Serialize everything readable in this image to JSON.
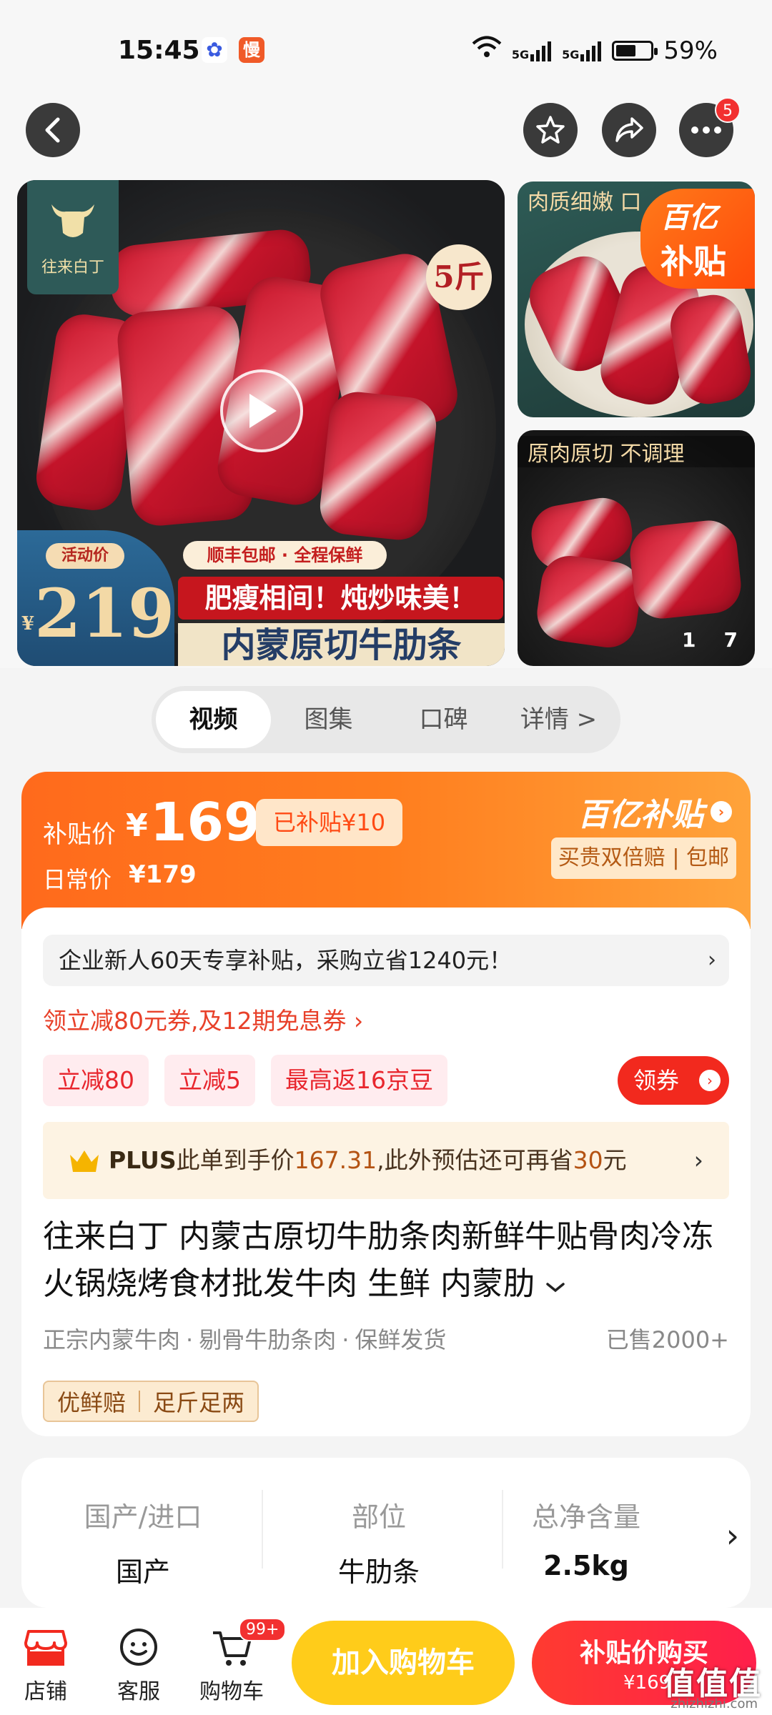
{
  "status_bar": {
    "time": "15:45",
    "app_icon_2": "慢",
    "network_1": "5G",
    "network_2": "5G",
    "battery_percent": "59%",
    "battery_level": 0.59
  },
  "header": {
    "back_icon": "chevron-left-icon",
    "favorite_icon": "star-icon",
    "share_icon": "share-icon",
    "more_icon": "more-icon",
    "more_badge": "5"
  },
  "gallery": {
    "brand_name": "往来白丁",
    "weight_tag": "5斤",
    "promo_label": "活动价",
    "promo_currency": "¥",
    "promo_price": "219",
    "shipping_text": "顺丰包邮 · 全程保鲜",
    "slogan_1": "肥瘦相间！炖炒味美！",
    "slogan_2": "内蒙原切牛肋条",
    "side_top_caption": "肉质细嫩 口",
    "side_bottom_caption": "原肉原切 不调理",
    "subsidy_badge_line1": "百亿",
    "subsidy_badge_line2": "补贴",
    "image_counter_current": "1",
    "image_counter_total": "7"
  },
  "tabs": [
    {
      "label": "视频",
      "active": true
    },
    {
      "label": "图集",
      "active": false
    },
    {
      "label": "口碑",
      "active": false
    },
    {
      "label": "详情 >",
      "active": false
    }
  ],
  "price": {
    "subsidy_label": "补贴价",
    "currency": "¥",
    "subsidy_value": "169",
    "saved_tag": "已补贴¥10",
    "daily_label": "日常价",
    "daily_value": "¥179",
    "program_title": "百亿补贴",
    "guarantee": "买贵双倍赔 | 包邮"
  },
  "offers": {
    "notice": "企业新人60天专享补贴，采购立省1240元！",
    "coupon_link": "领立减80元券,及12期免息券 ›",
    "chips": [
      "立减80",
      "立减5",
      "最高返16京豆"
    ],
    "claim_button": "领券",
    "plus_prefix": "PLUS",
    "plus_text_1": "此单到手价",
    "plus_price": "167.31",
    "plus_text_2": ",此外预估还可再省",
    "plus_save": "30",
    "plus_text_3": "元"
  },
  "product": {
    "title": "往来白丁 内蒙古原切牛肋条肉新鲜牛贴骨肉冷冻火锅烧烤食材批发牛肉 生鲜 内蒙肋",
    "tag_1": "正宗内蒙牛肉",
    "tag_2": "剔骨牛肋条肉",
    "tag_3": "保鲜发货",
    "sold": "已售2000+",
    "guarantee_1": "优鲜赔",
    "guarantee_2": "足斤足两"
  },
  "specs": [
    {
      "key": "国产/进口",
      "value": "国产"
    },
    {
      "key": "部位",
      "value": "牛肋条"
    },
    {
      "key": "总净含量",
      "value": "2.5kg"
    }
  ],
  "bottom_bar": {
    "store": "店铺",
    "service": "客服",
    "cart": "购物车",
    "cart_badge": "99+",
    "add_to_cart": "加入购物车",
    "buy_label": "补贴价购买",
    "buy_price": "¥169"
  },
  "watermark": {
    "text": "值值值",
    "sub": "zhizhizhi.com"
  },
  "colors": {
    "accent_orange": "#ff6a1c",
    "primary_red": "#f2291e",
    "cart_yellow": "#ffcc1a"
  }
}
